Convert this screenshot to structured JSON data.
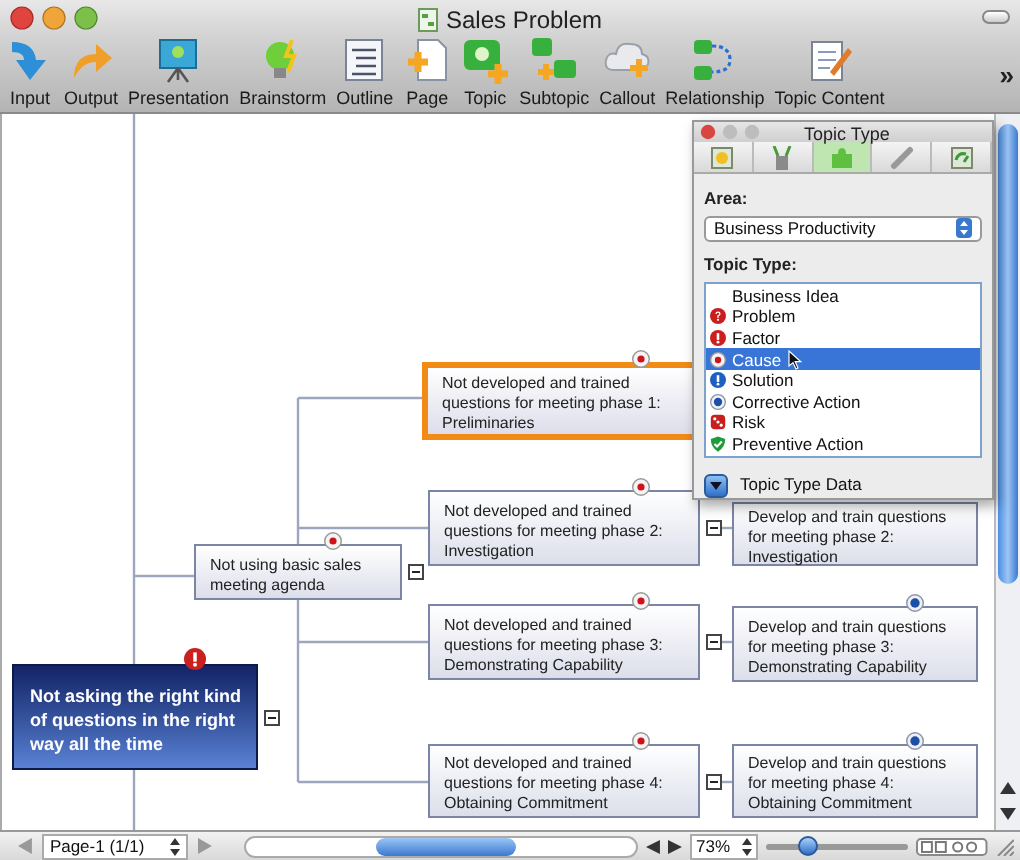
{
  "window": {
    "title": "Sales Problem"
  },
  "toolbar": [
    {
      "label": "Input"
    },
    {
      "label": "Output"
    },
    {
      "label": "Presentation"
    },
    {
      "label": "Brainstorm"
    },
    {
      "label": "Outline"
    },
    {
      "label": "Page"
    },
    {
      "label": "Topic"
    },
    {
      "label": "Subtopic"
    },
    {
      "label": "Callout"
    },
    {
      "label": "Relationship"
    },
    {
      "label": "Topic Content"
    }
  ],
  "toolbar_overflow": "»",
  "topics": [
    {
      "text": "Not asking the right kind of questions in the right way all the time",
      "kind": "factor",
      "selected": false,
      "expanded": true
    },
    {
      "text": "Not using basic sales meeting agenda",
      "kind": "cause",
      "selected": false,
      "expanded": true
    },
    {
      "text": "Not developed and trained questions for meeting phase 1: Preliminaries",
      "kind": "cause",
      "selected": true
    },
    {
      "text": "Not developed and trained questions for meeting phase 2: Investigation",
      "kind": "cause",
      "selected": false,
      "expanded": true
    },
    {
      "text": "Not developed and trained questions for meeting phase 3: Demonstrating Capability",
      "kind": "cause",
      "selected": false,
      "expanded": true
    },
    {
      "text": "Not developed and trained questions for meeting phase 4: Obtaining Commitment",
      "kind": "cause",
      "selected": false,
      "expanded": true
    },
    {
      "text": "Develop and train questions for meeting phase 2: Investigation",
      "kind": "none",
      "selected": false
    },
    {
      "text": "Develop and train questions for meeting phase 3: Demonstrating Capability",
      "kind": "corrective",
      "selected": false
    },
    {
      "text": "Develop and train questions for meeting phase 4: Obtaining Commitment",
      "kind": "corrective",
      "selected": false
    }
  ],
  "panel": {
    "title": "Topic Type",
    "tabs": [
      {
        "selected": false
      },
      {
        "selected": false
      },
      {
        "selected": true
      },
      {
        "selected": false
      },
      {
        "selected": false
      }
    ],
    "area_label": "Area:",
    "area_value": "Business Productivity",
    "type_label": "Topic Type:",
    "types": [
      {
        "label": "Business Idea",
        "kind": "none",
        "selected": false
      },
      {
        "label": "Problem",
        "kind": "problem",
        "selected": false
      },
      {
        "label": "Factor",
        "kind": "factor",
        "selected": false
      },
      {
        "label": "Cause",
        "kind": "cause",
        "selected": true
      },
      {
        "label": "Solution",
        "kind": "solution",
        "selected": false
      },
      {
        "label": "Corrective Action",
        "kind": "corrective",
        "selected": false
      },
      {
        "label": "Risk",
        "kind": "risk",
        "selected": false
      },
      {
        "label": "Preventive Action",
        "kind": "preventive",
        "selected": false
      }
    ],
    "data_label": "Topic Type Data"
  },
  "status_bar": {
    "page": "Page-1 (1/1)",
    "zoom": "73%",
    "zoom_slider": {
      "level": 0.3
    }
  }
}
